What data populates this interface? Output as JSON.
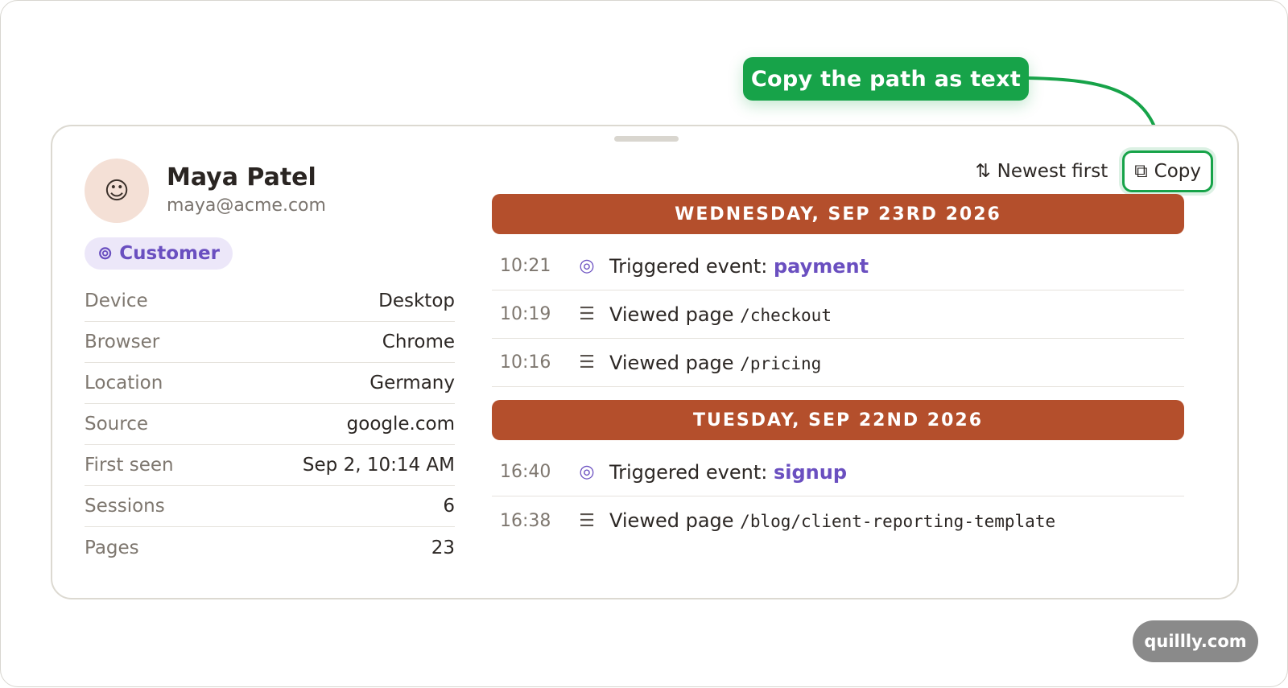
{
  "callout": {
    "text": "Copy the path as text"
  },
  "profile": {
    "name": "Maya Patel",
    "email": "maya@acme.com",
    "avatar_icon": "smiley-icon",
    "badge": {
      "icon": "⊚",
      "label": "Customer"
    },
    "details": [
      {
        "label": "Device",
        "value": "Desktop"
      },
      {
        "label": "Browser",
        "value": "Chrome"
      },
      {
        "label": "Location",
        "value": "Germany"
      },
      {
        "label": "Source",
        "value": "google.com"
      },
      {
        "label": "First seen",
        "value": "Sep 2, 10:14 AM"
      },
      {
        "label": "Sessions",
        "value": "6"
      },
      {
        "label": "Pages",
        "value": "23"
      }
    ]
  },
  "toolbar": {
    "sort_label": "Newest first",
    "copy_label": "Copy"
  },
  "timeline": {
    "days": [
      {
        "header": "WEDNESDAY, SEP 23RD 2026",
        "events": [
          {
            "time": "10:21",
            "type": "event",
            "prefix": "Triggered event:",
            "target": "payment"
          },
          {
            "time": "10:19",
            "type": "page",
            "prefix": "Viewed page",
            "target": "/checkout"
          },
          {
            "time": "10:16",
            "type": "page",
            "prefix": "Viewed page",
            "target": "/pricing"
          }
        ]
      },
      {
        "header": "TUESDAY, SEP 22ND 2026",
        "events": [
          {
            "time": "16:40",
            "type": "event",
            "prefix": "Triggered event:",
            "target": "signup"
          },
          {
            "time": "16:38",
            "type": "page",
            "prefix": "Viewed page",
            "target": "/blog/client-reporting-template"
          }
        ]
      }
    ]
  },
  "watermark": {
    "text": "quillly.com"
  },
  "colors": {
    "accent_green": "#17a349",
    "day_header": "#b44f2c",
    "event_purple": "#6a4fc0",
    "badge_bg": "#ece7f9"
  }
}
